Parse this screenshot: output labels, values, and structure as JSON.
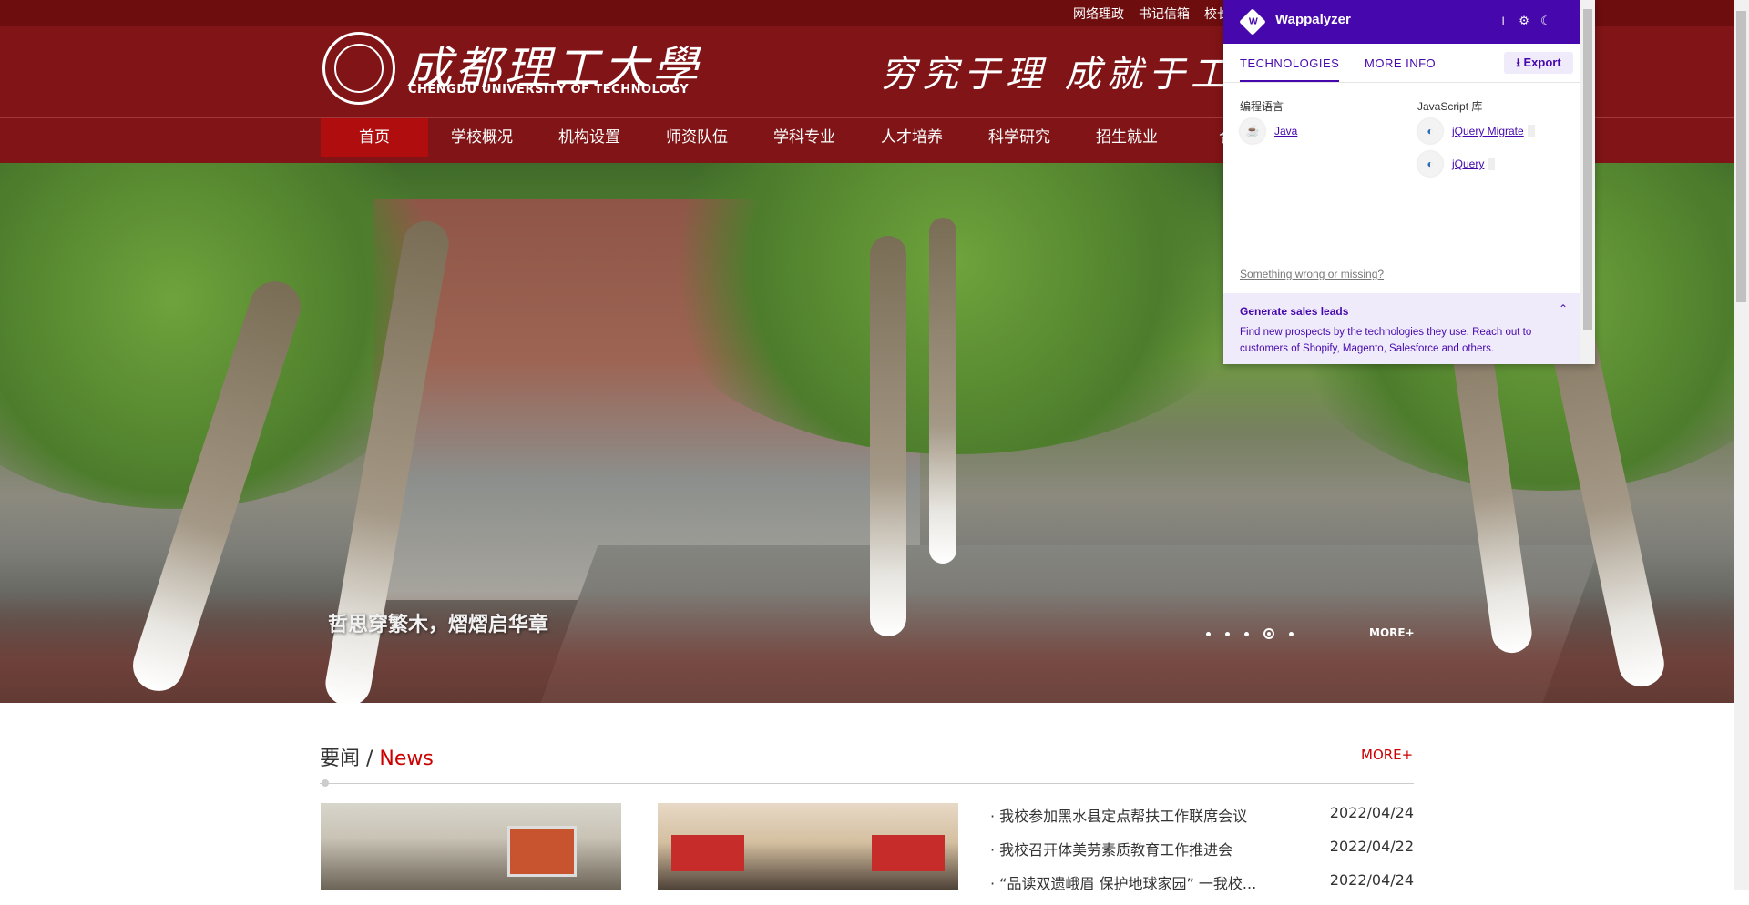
{
  "top_links": [
    "网络理政",
    "书记信箱",
    "校长"
  ],
  "header": {
    "logo_cn": "成都理工大學",
    "logo_en": "CHENGDU UNIVERSITY OF TECHNOLOGY",
    "motto": "穷究于理 成就于工"
  },
  "nav": [
    "首页",
    "学校概况",
    "机构设置",
    "师资队伍",
    "学科专业",
    "人才培养",
    "科学研究",
    "招生就业",
    "合作"
  ],
  "hero": {
    "caption": "哲思穿繁木，熠熠启华章",
    "more": "MORE+",
    "slide_count": 5,
    "active_slide": 4
  },
  "news": {
    "title_cn": "要闻",
    "separator": " / ",
    "title_en": "News",
    "more": "MORE+",
    "items": [
      {
        "title": "· 我校参加黑水县定点帮扶工作联席会议",
        "date": "2022/04/24"
      },
      {
        "title": "· 我校召开体美劳素质教育工作推进会",
        "date": "2022/04/22"
      },
      {
        "title": "· “品读双遗峨眉 保护地球家园” 一我校...",
        "date": "2022/04/24"
      }
    ]
  },
  "wappalyzer": {
    "name": "Wappalyzer",
    "tabs": [
      "TECHNOLOGIES",
      "MORE INFO"
    ],
    "export": "Export",
    "categories": [
      {
        "name": "编程语言",
        "techs": [
          "Java"
        ]
      },
      {
        "name": "JavaScript 库",
        "techs": [
          "jQuery Migrate",
          "jQuery"
        ]
      }
    ],
    "wrong": "Something wrong or missing?",
    "leads_title": "Generate sales leads",
    "leads_text": "Find new prospects by the technologies they use. Reach out to customers of Shopify, Magento, Salesforce and others."
  }
}
